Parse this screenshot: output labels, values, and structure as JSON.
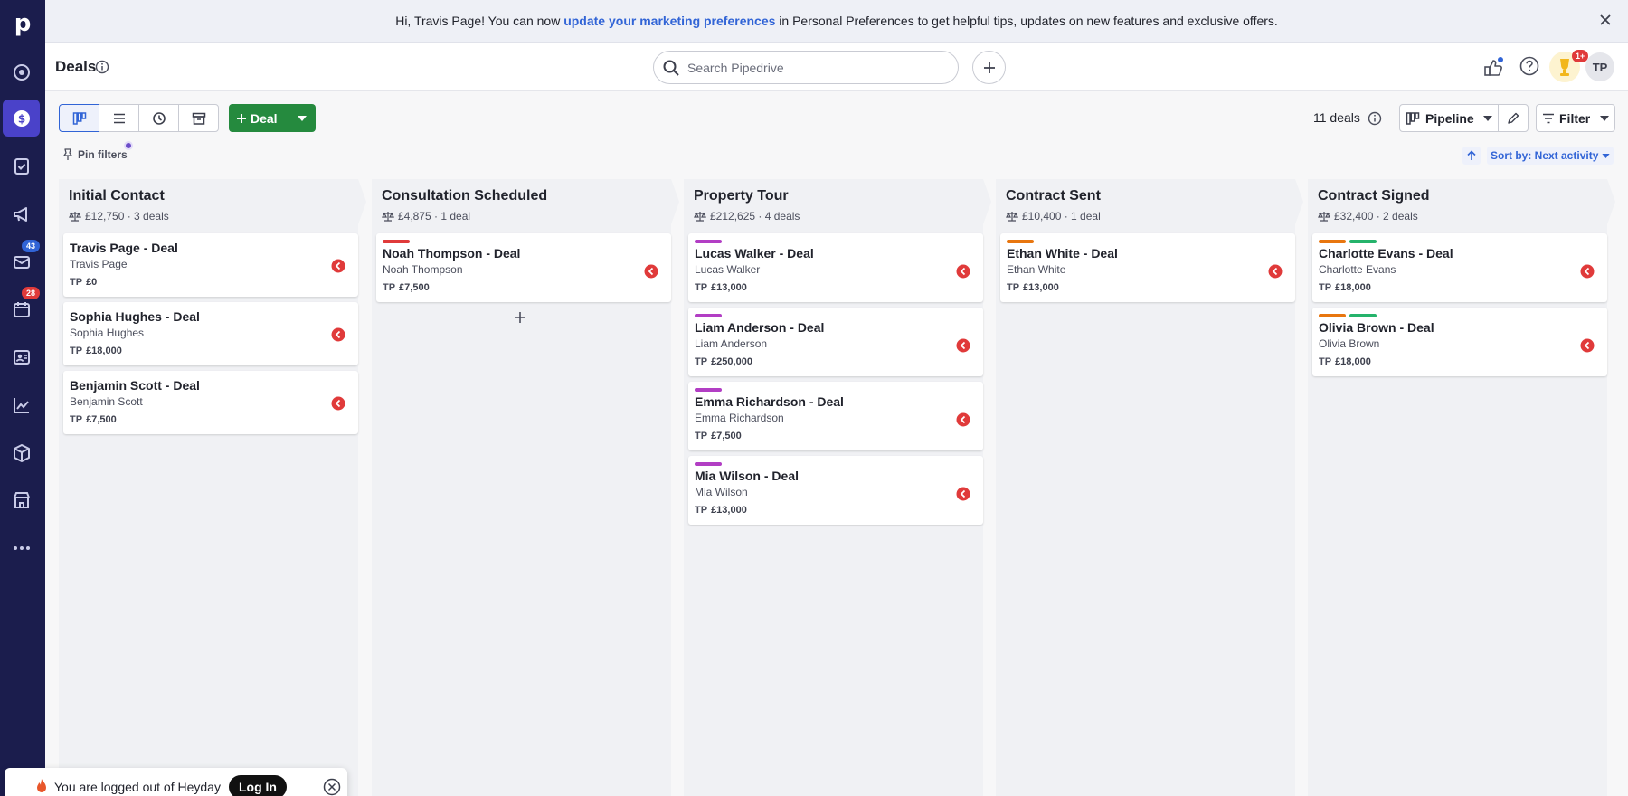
{
  "app": {
    "logo": "p"
  },
  "banner": {
    "text_before": "Hi, Travis Page! You can now ",
    "link": "update your marketing preferences",
    "text_after": " in Personal Preferences to get helpful tips, updates on new features and exclusive offers."
  },
  "sidebar": {
    "badges": {
      "mail": "43",
      "activities": "28"
    }
  },
  "header": {
    "title": "Deals",
    "search_placeholder": "Search Pipedrive",
    "notif_badge": "1+",
    "user_initials": "TP"
  },
  "toolbar": {
    "deal_label": "Deal",
    "pin_filters": "Pin filters",
    "deals_count": "11 deals",
    "pipeline_label": "Pipeline",
    "filter_label": "Filter",
    "sort_label": "Sort by: Next activity"
  },
  "colors": {
    "rail": "#1b1d4d",
    "active_nav": "#4a42c9",
    "primary_green": "#258a3e",
    "link_blue": "#3164d6",
    "status_red": "#e03a3a"
  },
  "board": {
    "columns": [
      {
        "title": "Initial Contact",
        "summary": "£12,750 · 3 deals",
        "deals": [
          {
            "title": "Travis Page - Deal",
            "person": "Travis Page",
            "owner": "TP",
            "value": "£0",
            "labels": []
          },
          {
            "title": "Sophia Hughes - Deal",
            "person": "Sophia Hughes",
            "owner": "TP",
            "value": "£18,000",
            "labels": []
          },
          {
            "title": "Benjamin Scott - Deal",
            "person": "Benjamin Scott",
            "owner": "TP",
            "value": "£7,500",
            "labels": []
          }
        ]
      },
      {
        "title": "Consultation Scheduled",
        "summary": "£4,875 · 1 deal",
        "deals": [
          {
            "title": "Noah Thompson - Deal",
            "person": "Noah Thompson",
            "owner": "TP",
            "value": "£7,500",
            "labels": [
              "#e03a3a"
            ]
          }
        ]
      },
      {
        "title": "Property Tour",
        "summary": "£212,625 · 4 deals",
        "deals": [
          {
            "title": "Lucas Walker - Deal",
            "person": "Lucas Walker",
            "owner": "TP",
            "value": "£13,000",
            "labels": [
              "#b23ec4"
            ]
          },
          {
            "title": "Liam Anderson - Deal",
            "person": "Liam Anderson",
            "owner": "TP",
            "value": "£250,000",
            "labels": [
              "#b23ec4"
            ]
          },
          {
            "title": "Emma Richardson - Deal",
            "person": "Emma Richardson",
            "owner": "TP",
            "value": "£7,500",
            "labels": [
              "#b23ec4"
            ]
          },
          {
            "title": "Mia Wilson - Deal",
            "person": "Mia Wilson",
            "owner": "TP",
            "value": "£13,000",
            "labels": [
              "#b23ec4"
            ]
          }
        ]
      },
      {
        "title": "Contract Sent",
        "summary": "£10,400 · 1 deal",
        "deals": [
          {
            "title": "Ethan White - Deal",
            "person": "Ethan White",
            "owner": "TP",
            "value": "£13,000",
            "labels": [
              "#e8760f"
            ]
          }
        ]
      },
      {
        "title": "Contract Signed",
        "summary": "£32,400 · 2 deals",
        "deals": [
          {
            "title": "Charlotte Evans - Deal",
            "person": "Charlotte Evans",
            "owner": "TP",
            "value": "£18,000",
            "labels": [
              "#e8760f",
              "#25b36b"
            ]
          },
          {
            "title": "Olivia Brown - Deal",
            "person": "Olivia Brown",
            "owner": "TP",
            "value": "£18,000",
            "labels": [
              "#e8760f",
              "#25b36b"
            ]
          }
        ]
      }
    ]
  },
  "toast": {
    "text": "You are logged out of Heyday",
    "login_label": "Log In"
  }
}
